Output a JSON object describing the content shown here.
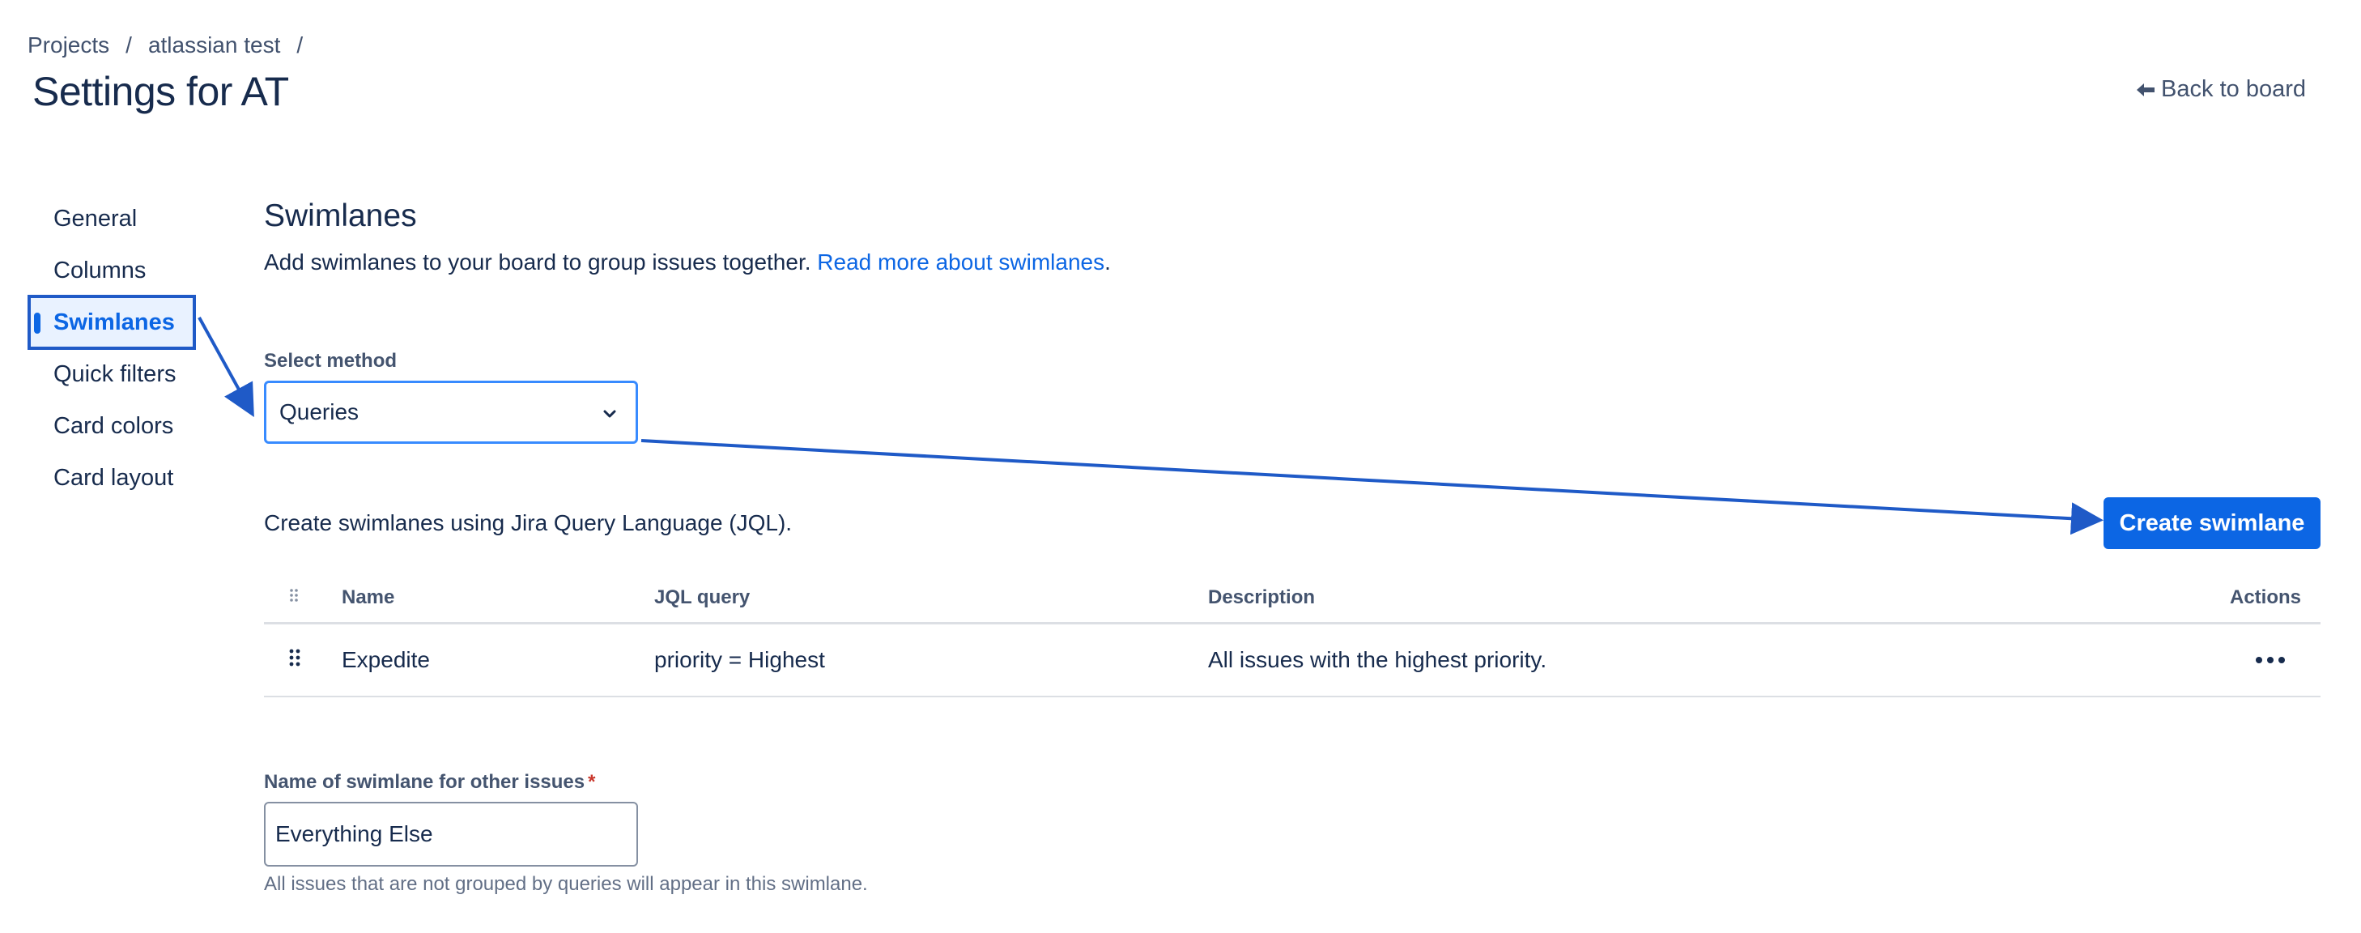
{
  "breadcrumb": {
    "items": [
      "Projects",
      "atlassian test"
    ],
    "separator": "/"
  },
  "page": {
    "title": "Settings for AT",
    "back_label": "Back to board",
    "back_icon": "arrow-left-icon"
  },
  "sidebar": {
    "active": "Swimlanes",
    "items": [
      {
        "label": "General"
      },
      {
        "label": "Columns"
      },
      {
        "label": "Swimlanes"
      },
      {
        "label": "Quick filters"
      },
      {
        "label": "Card colors"
      },
      {
        "label": "Card layout"
      }
    ]
  },
  "swimlanes": {
    "title": "Swimlanes",
    "description": "Add swimlanes to your board to group issues together.",
    "read_more": "Read more about swimlanes",
    "description_end": ".",
    "select_label": "Select method",
    "select_value": "Queries",
    "jql_description": "Create swimlanes using Jira Query Language (JQL).",
    "create_button": "Create swimlane"
  },
  "table": {
    "columns": {
      "name": "Name",
      "jql": "JQL query",
      "description": "Description",
      "actions": "Actions"
    },
    "rows": [
      {
        "name": "Expedite",
        "jql": "priority = Highest",
        "description": "All issues with the highest priority."
      }
    ]
  },
  "other": {
    "label": "Name of swimlane for other issues",
    "required_mark": "*",
    "value": "Everything Else",
    "help": "All issues that are not grouped by queries will appear in this swimlane."
  },
  "colors": {
    "accent": "#0c66e4",
    "annotation": "#1f5ac7",
    "text": "#172b4d",
    "subtle_text": "#44546f"
  }
}
